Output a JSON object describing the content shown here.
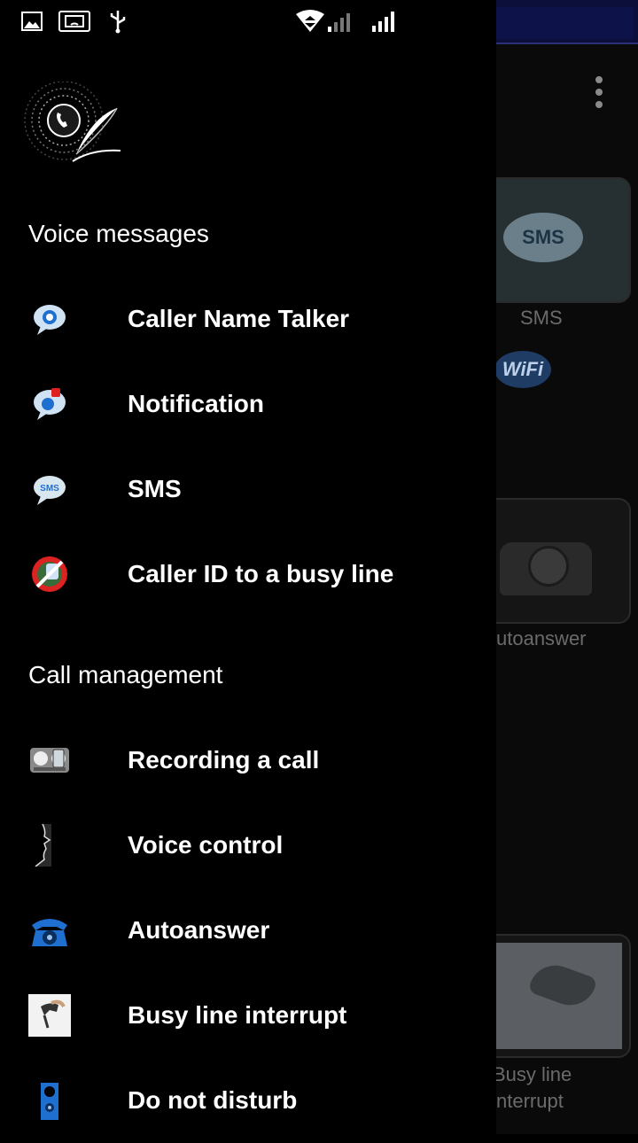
{
  "background": {
    "tiles": [
      {
        "label": "SMS"
      },
      {
        "label": "Autoanswer",
        "visible_label": "utoanswer"
      },
      {
        "label_line1": "Busy line",
        "label_line2": "nterrupt"
      }
    ],
    "sms_bubble_text": "SMS",
    "wifi_badge_text": "WiFi"
  },
  "drawer": {
    "sections": [
      {
        "title": "Voice messages",
        "items": [
          {
            "label": "Caller Name Talker",
            "icon": "talking-bubble-icon"
          },
          {
            "label": "Notification",
            "icon": "notification-bubble-icon"
          },
          {
            "label": "SMS",
            "icon": "sms-bubble-icon"
          },
          {
            "label": "Caller ID to a busy line",
            "icon": "busy-line-caller-id-icon"
          }
        ]
      },
      {
        "title": "Call management",
        "items": [
          {
            "label": "Recording a call",
            "icon": "recorder-icon"
          },
          {
            "label": "Voice control",
            "icon": "face-profile-icon"
          },
          {
            "label": "Autoanswer",
            "icon": "rotary-phone-icon"
          },
          {
            "label": "Busy line interrupt",
            "icon": "hand-phone-icon"
          },
          {
            "label": "Do not disturb",
            "icon": "door-hanger-icon"
          }
        ]
      }
    ]
  },
  "colors": {
    "drawer_bg": "#000000",
    "text": "#ffffff",
    "muted": "#6b6b6b",
    "accent_blue": "#1f6fd1"
  }
}
